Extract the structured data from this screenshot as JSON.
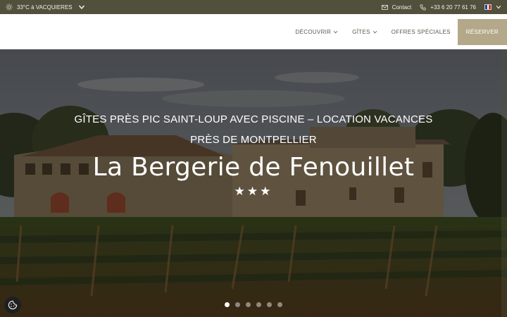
{
  "topbar": {
    "weather": "33°C à VACQUIERES",
    "contact": "Contact",
    "phone": "+33 6 20 77 61 76",
    "language_icon": "french-flag-icon"
  },
  "nav": {
    "items": [
      "DÉCOUVRIR",
      "GÎTES",
      "OFFRES SPÉCIALES"
    ],
    "reserve": "RÉSERVER"
  },
  "hero": {
    "subtitle_line1": "GÎTES PRÈS PIC SAINT-LOUP AVEC PISCINE – LOCATION VACANCES",
    "subtitle_line2": "PRÈS DE MONTPELLIER",
    "title": "La Bergerie de Fenouillet",
    "stars": "★★★",
    "slides_count": 6,
    "active_slide": 1
  },
  "colors": {
    "topbar_bg": "#51503d",
    "reserve_bg": "#b4a88a",
    "nav_text": "#5b594c"
  }
}
